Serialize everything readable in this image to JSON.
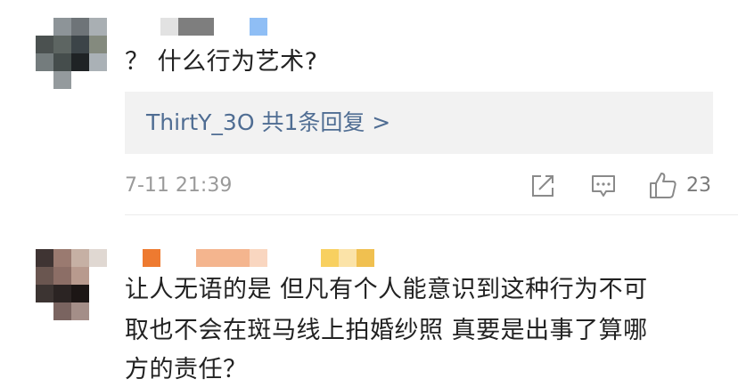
{
  "comments": [
    {
      "avatar_colors": [
        "#ffffff",
        "#8d9498",
        "#6e7478",
        "#a9afb3",
        "#4b5150",
        "#5d6562",
        "#3c4448",
        "#848a7e",
        "#747c7d",
        "#454d4c",
        "#1f2325",
        "#aab1b6",
        "#ffffff",
        "#949a9d",
        "#ffffff",
        "#ffffff"
      ],
      "name_block_colors": [
        "#dedede",
        "#8a8a8a",
        "#6e6e6e",
        "#8fbef5"
      ],
      "text": "？ 什么行为艺术?",
      "reply_summary": "ThirtY_3O  共1条回复 >",
      "timestamp": "7-11 21:39",
      "actions": {
        "share_icon": "share-icon",
        "comment_icon": "comment-icon",
        "like_icon": "thumbs-up-icon",
        "like_count": "23"
      }
    },
    {
      "avatar_colors": [
        "#3f3433",
        "#9a7a70",
        "#c6b0a4",
        "#e0d8d2",
        "#6a5650",
        "#8c6e66",
        "#b89a8e",
        "#ffffff",
        "#3c3432",
        "#2b2423",
        "#1c1615",
        "#ffffff",
        "#ffffff",
        "#7a6460",
        "#a48e88",
        "#ffffff"
      ],
      "name_block_colors": [
        "#ee7a30",
        "#f4b58e",
        "#f7c8a8",
        "#f8d060",
        "#f0c050"
      ],
      "text_lines": [
        "让人无语的是 但凡有个人能意识到这种行为不可",
        "取也不会在斑马线上拍婚纱照 真要是出事了算哪",
        "方的责任？"
      ]
    }
  ]
}
